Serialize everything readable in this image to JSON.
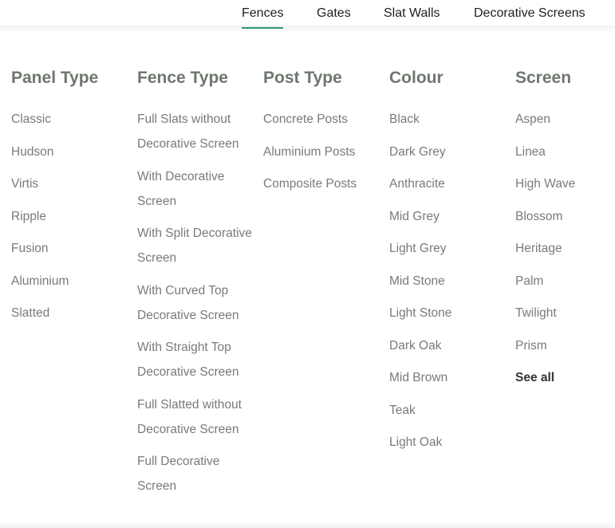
{
  "nav": {
    "tabs": [
      {
        "label": "Fences",
        "active": true
      },
      {
        "label": "Gates",
        "active": false
      },
      {
        "label": "Slat Walls",
        "active": false
      },
      {
        "label": "Decorative Screens",
        "active": false
      }
    ],
    "accent_color": "#2f9e73"
  },
  "menu": {
    "columns": [
      {
        "title": "Panel Type",
        "items": [
          "Classic",
          "Hudson",
          "Virtis",
          "Ripple",
          "Fusion",
          "Aluminium",
          "Slatted"
        ]
      },
      {
        "title": "Fence Type",
        "items": [
          "Full Slats without Decorative Screen",
          "With Decorative Screen",
          "With Split Decorative Screen",
          "With Curved Top Decorative Screen",
          "With Straight Top Decorative Screen",
          "Full Slatted without Decorative Screen",
          "Full Decorative Screen"
        ]
      },
      {
        "title": "Post Type",
        "items": [
          "Concrete Posts",
          "Aluminium Posts",
          "Composite Posts"
        ]
      },
      {
        "title": "Colour",
        "items": [
          "Black",
          "Dark Grey",
          "Anthracite",
          "Mid Grey",
          "Light Grey",
          "Mid Stone",
          "Light Stone",
          "Dark Oak",
          "Mid Brown",
          "Teak",
          "Light Oak"
        ]
      },
      {
        "title": "Screen",
        "items": [
          "Aspen",
          "Linea",
          "High Wave",
          "Blossom",
          "Heritage",
          "Palm",
          "Twilight",
          "Prism"
        ],
        "see_all": "See all"
      }
    ]
  }
}
